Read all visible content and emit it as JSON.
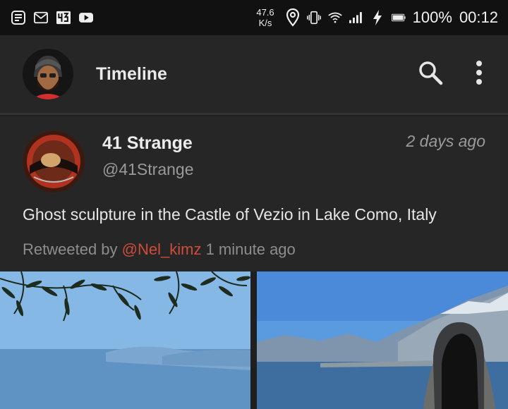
{
  "status_bar": {
    "net_speed_value": "47.6",
    "net_speed_unit": "K/s",
    "battery": "100%",
    "clock": "00:12",
    "notification_icons": [
      "notes-icon",
      "gmail-icon",
      "app-43-icon",
      "youtube-icon"
    ],
    "system_icons": [
      "location-icon",
      "vibrate-icon",
      "wifi-icon",
      "signal-icon",
      "charging-icon",
      "battery-icon"
    ]
  },
  "app_bar": {
    "title": "Timeline"
  },
  "tweet": {
    "author_name": "41 Strange",
    "author_handle": "@41Strange",
    "time": "2 days ago",
    "text": "Ghost sculpture in the Castle of Vezio in Lake Como, Italy",
    "retweeted_by_label": "Retweeted by",
    "retweeted_by_user": "@Nel_kimz",
    "retweeted_time": "1 minute ago"
  },
  "colors": {
    "background": "#1f1f1f",
    "surface": "#262626",
    "accent_handle": "#d14b3a",
    "secondary_text": "#9a9a9a"
  }
}
